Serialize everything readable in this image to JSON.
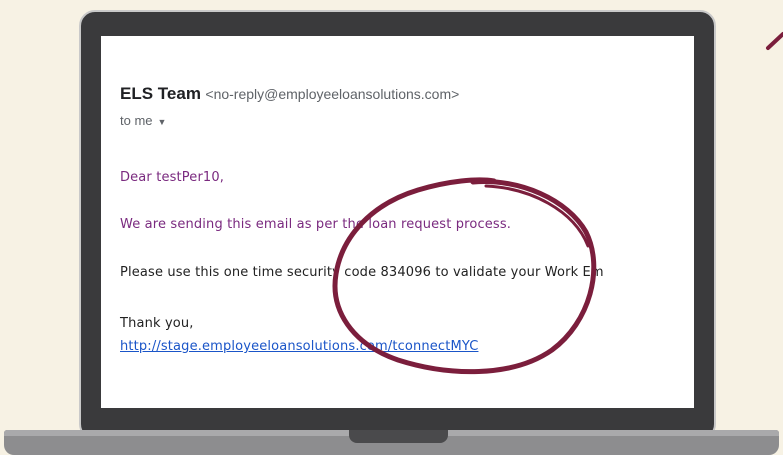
{
  "email": {
    "sender_name": "ELS Team",
    "sender_email": "<no-reply@employeeloansolutions.com>",
    "recipient_label": "to me",
    "greeting": "Dear testPer10,",
    "intro": "We are sending this email as per the loan request process.",
    "instruction": "Please use this one time security code 834096 to validate your Work Em",
    "closing": "Thank you,",
    "link_text": "http://stage.employeeloansolutions.com/tconnectMYC"
  },
  "colors": {
    "background": "#f7f2e4",
    "annotation": "#7b1e3c",
    "purple_text": "#7a2a7f",
    "link": "#1a55c8"
  },
  "annotation_icons": [
    "highlight-circle",
    "corner-mark"
  ]
}
